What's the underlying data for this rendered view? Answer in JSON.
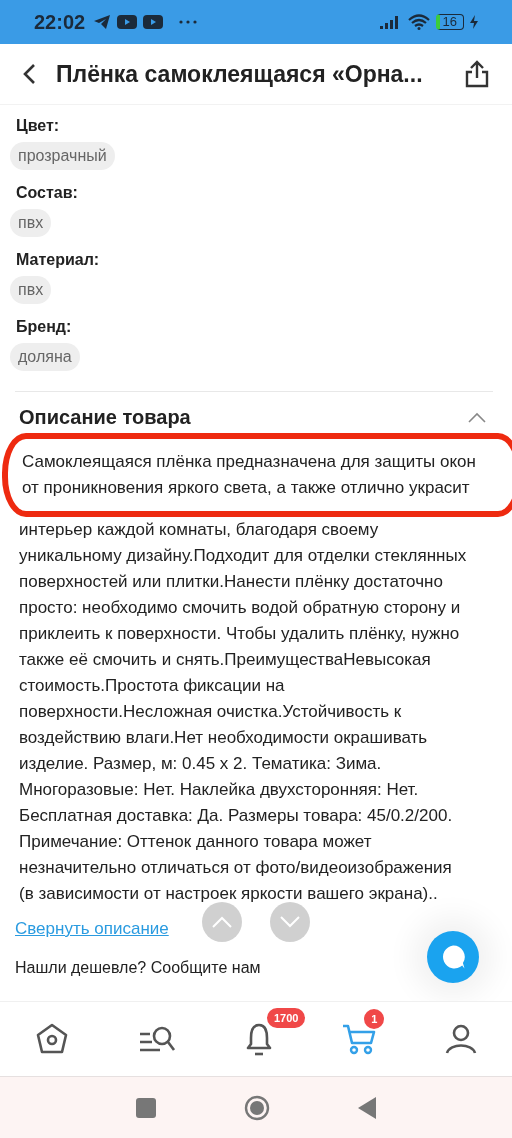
{
  "status_bar": {
    "time": "22:02",
    "battery": "16"
  },
  "header": {
    "title": "Плёнка самоклеящаяся «Орна..."
  },
  "attributes": [
    {
      "label": "Цвет:",
      "value": "прозрачный"
    },
    {
      "label": "Состав:",
      "value": "пвх"
    },
    {
      "label": "Материал:",
      "value": "пвх"
    },
    {
      "label": "Бренд:",
      "value": "доляна"
    }
  ],
  "description": {
    "title": "Описание товара",
    "expanded": true,
    "annotated_text": "Самоклеящаяся плёнка предназначена для защиты окон от проникновения яркого света, а также отлично украсит",
    "text": "интерьер каждой комнаты, благодаря своему уникальному дизайну.Подходит для отделки стеклянных поверхностей или плитки.Нанести плёнку достаточно просто: необходимо смочить водой обратную сторону и приклеить к поверхности. Чтобы удалить плёнку, нужно также её смочить и снять.ПреимуществаНевысокая стоимость.Простота фиксации на поверхности.Несложная очистка.Устойчивость к воздействию влаги.Нет необходимости окрашивать изделие. Размер, м: 0.45 х 2. Тематика: Зима. Многоразовые: Нет. Наклейка двухсторонняя: Нет. Бесплатная доставка: Да. Размеры товара: 45/0.2/200. Примечание: Оттенок данного товара может незначительно отличаться от фото/видеоизображения (в зависимости от настроек яркости вашего экрана)..",
    "collapse_link": "Свернуть описание"
  },
  "cheaper_prompt": "Нашли дешевле? Сообщите нам",
  "nav": [
    {
      "kind": "home",
      "selected": false
    },
    {
      "kind": "catalog",
      "selected": false
    },
    {
      "kind": "notifications",
      "selected": false,
      "badge": "1700"
    },
    {
      "kind": "cart",
      "selected": true,
      "badge": "1"
    },
    {
      "kind": "profile",
      "selected": false
    }
  ]
}
